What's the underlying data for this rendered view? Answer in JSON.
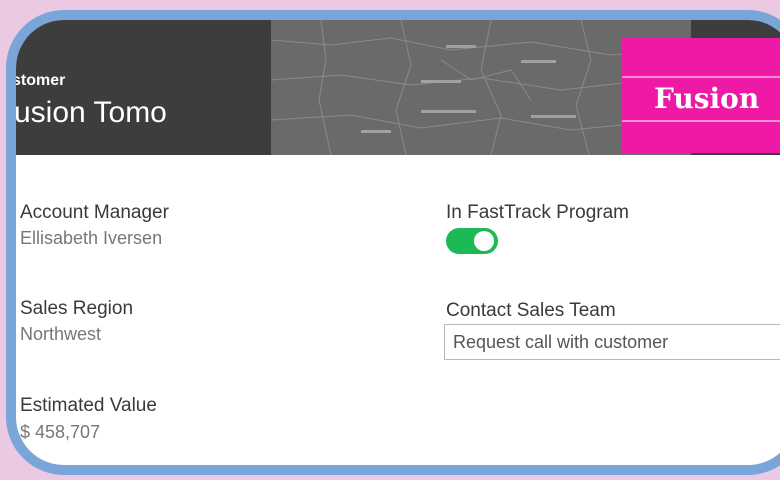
{
  "header": {
    "label": "stomer",
    "title": "usion Tomo",
    "logo_text": "Fusion"
  },
  "fields": {
    "account_manager": {
      "label": "Account Manager",
      "value": "Ellisabeth Iversen"
    },
    "sales_region": {
      "label": "Sales Region",
      "value": "Northwest"
    },
    "estimated_value": {
      "label": "Estimated Value",
      "value": "$ 458,707"
    },
    "fasttrack": {
      "label": "In FastTrack Program",
      "checked": true
    },
    "contact_sales": {
      "label": "Contact Sales Team",
      "value": "Request call with customer"
    }
  },
  "colors": {
    "frame": "#7aa5d8",
    "header": "#3d3d3d",
    "logo": "#ee1aa6",
    "toggle_on": "#1db954",
    "background": "#ecc9e2"
  }
}
